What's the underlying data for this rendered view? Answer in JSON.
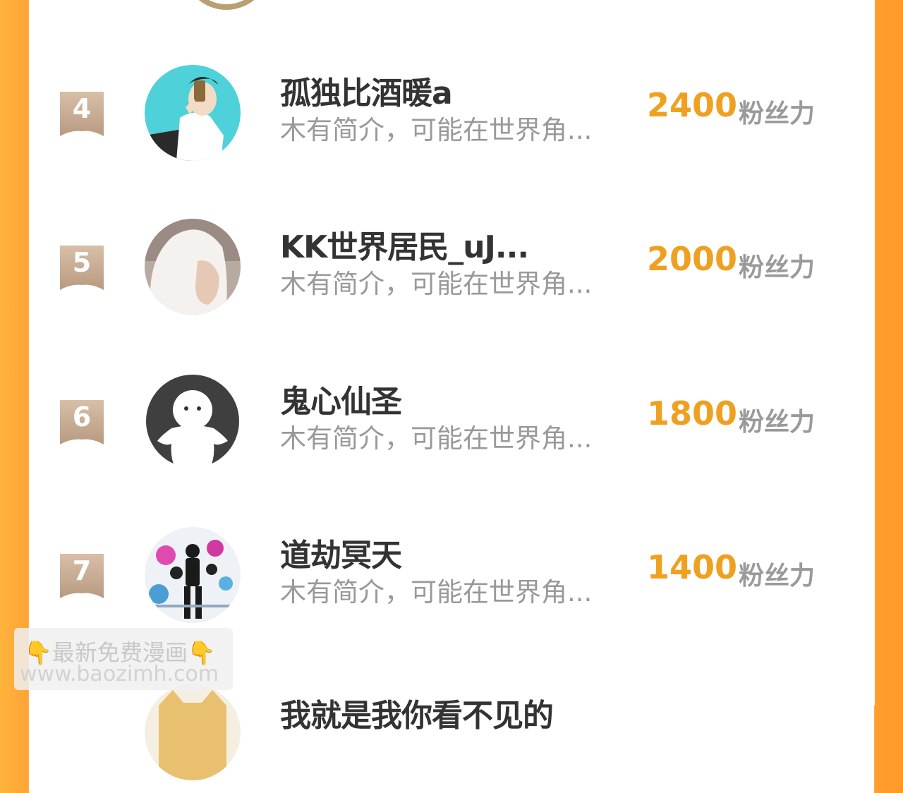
{
  "unit_label": "粉丝力",
  "rows": [
    {
      "rank": "4",
      "name": "孤独比酒暖a",
      "bio": "木有简介，可能在世界角...",
      "score": "2400",
      "avatar": "boy-photo-avatar"
    },
    {
      "rank": "5",
      "name": "KK世界居民_uJ...",
      "bio": "木有简介，可能在世界角...",
      "score": "2000",
      "avatar": "hooded-person-avatar"
    },
    {
      "rank": "6",
      "name": "鬼心仙圣",
      "bio": "木有简介，可能在世界角...",
      "score": "1800",
      "avatar": "default-ghost-avatar"
    },
    {
      "rank": "7",
      "name": "道劫冥天",
      "bio": "木有简介，可能在世界角...",
      "score": "1400",
      "avatar": "anime-city-avatar"
    },
    {
      "rank": "",
      "name": "我就是我你看不见的",
      "bio": "",
      "score": "",
      "avatar": "cat-avatar"
    }
  ],
  "watermark": {
    "line1": "最新免费漫画",
    "line2": "www.baozimh.com"
  },
  "colors": {
    "accent": "#f0a020",
    "badge": "#c9ab93",
    "frame_left": "#ffb43c",
    "frame_right": "#ff9a2a"
  }
}
